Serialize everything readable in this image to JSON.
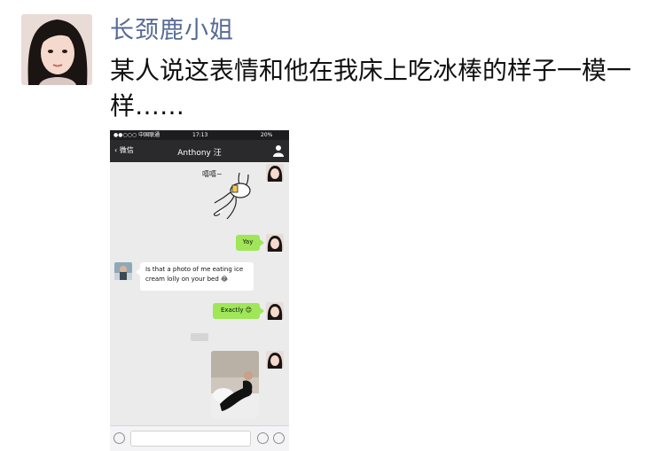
{
  "post": {
    "author": "长颈鹿小姐",
    "text": "某人说这表情和他在我床上吃冰棒的样子一模一样……"
  },
  "chat": {
    "status": {
      "carrier": "●●○○○ 中国联通",
      "time": "17:13",
      "battery": "20%"
    },
    "back_label": "微信",
    "title": "Anthony 汪",
    "sticker_text": "嘻嘻~",
    "messages": [
      {
        "side": "right",
        "text": "Yay"
      },
      {
        "side": "left",
        "text": "Is that a photo of me eating ice cream lolly on your bed 😂"
      },
      {
        "side": "right",
        "text": "Exactly 😊"
      }
    ]
  },
  "icons": [
    "person-icon",
    "voice-icon",
    "emoji-icon",
    "plus-icon",
    "back-chevron-icon"
  ],
  "colors": {
    "author_name": "#576b95",
    "green_bubble": "#9fe658",
    "nav_bar": "#2a2a2c",
    "chat_bg": "#ebebeb"
  }
}
